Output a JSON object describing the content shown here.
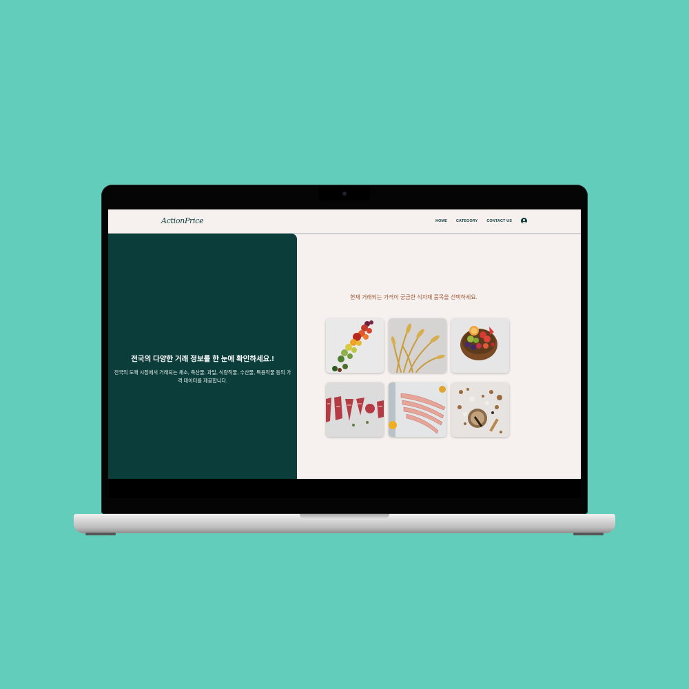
{
  "header": {
    "logo": "ActionPrice",
    "nav": [
      {
        "label": "HOME"
      },
      {
        "label": "CATEGORY"
      },
      {
        "label": "CONTACT US"
      }
    ],
    "user_icon": "user-circle-icon"
  },
  "hero": {
    "title": "전국의 다양한 거래 정보를 한 눈에 확인하세요.!",
    "description": "전국의 도매 시장에서 거래되는 채소, 축산물, 과일, 식량작물, 수산물, 특용작물 등의 가격 데이터를 제공합니다."
  },
  "main": {
    "prompt": "현재 거래되는 가격이 궁금한 식자재 품목을 선택하세요.",
    "categories": [
      {
        "icon": "vegetables-image"
      },
      {
        "icon": "grain-image"
      },
      {
        "icon": "fruit-bowl-image"
      },
      {
        "icon": "meat-image"
      },
      {
        "icon": "seafood-image"
      },
      {
        "icon": "specialty-crops-image"
      }
    ]
  },
  "colors": {
    "background": "#62cdbb",
    "brand_dark": "#0b3d3a",
    "accent": "#a0532d",
    "page": "#f6f1ef"
  }
}
